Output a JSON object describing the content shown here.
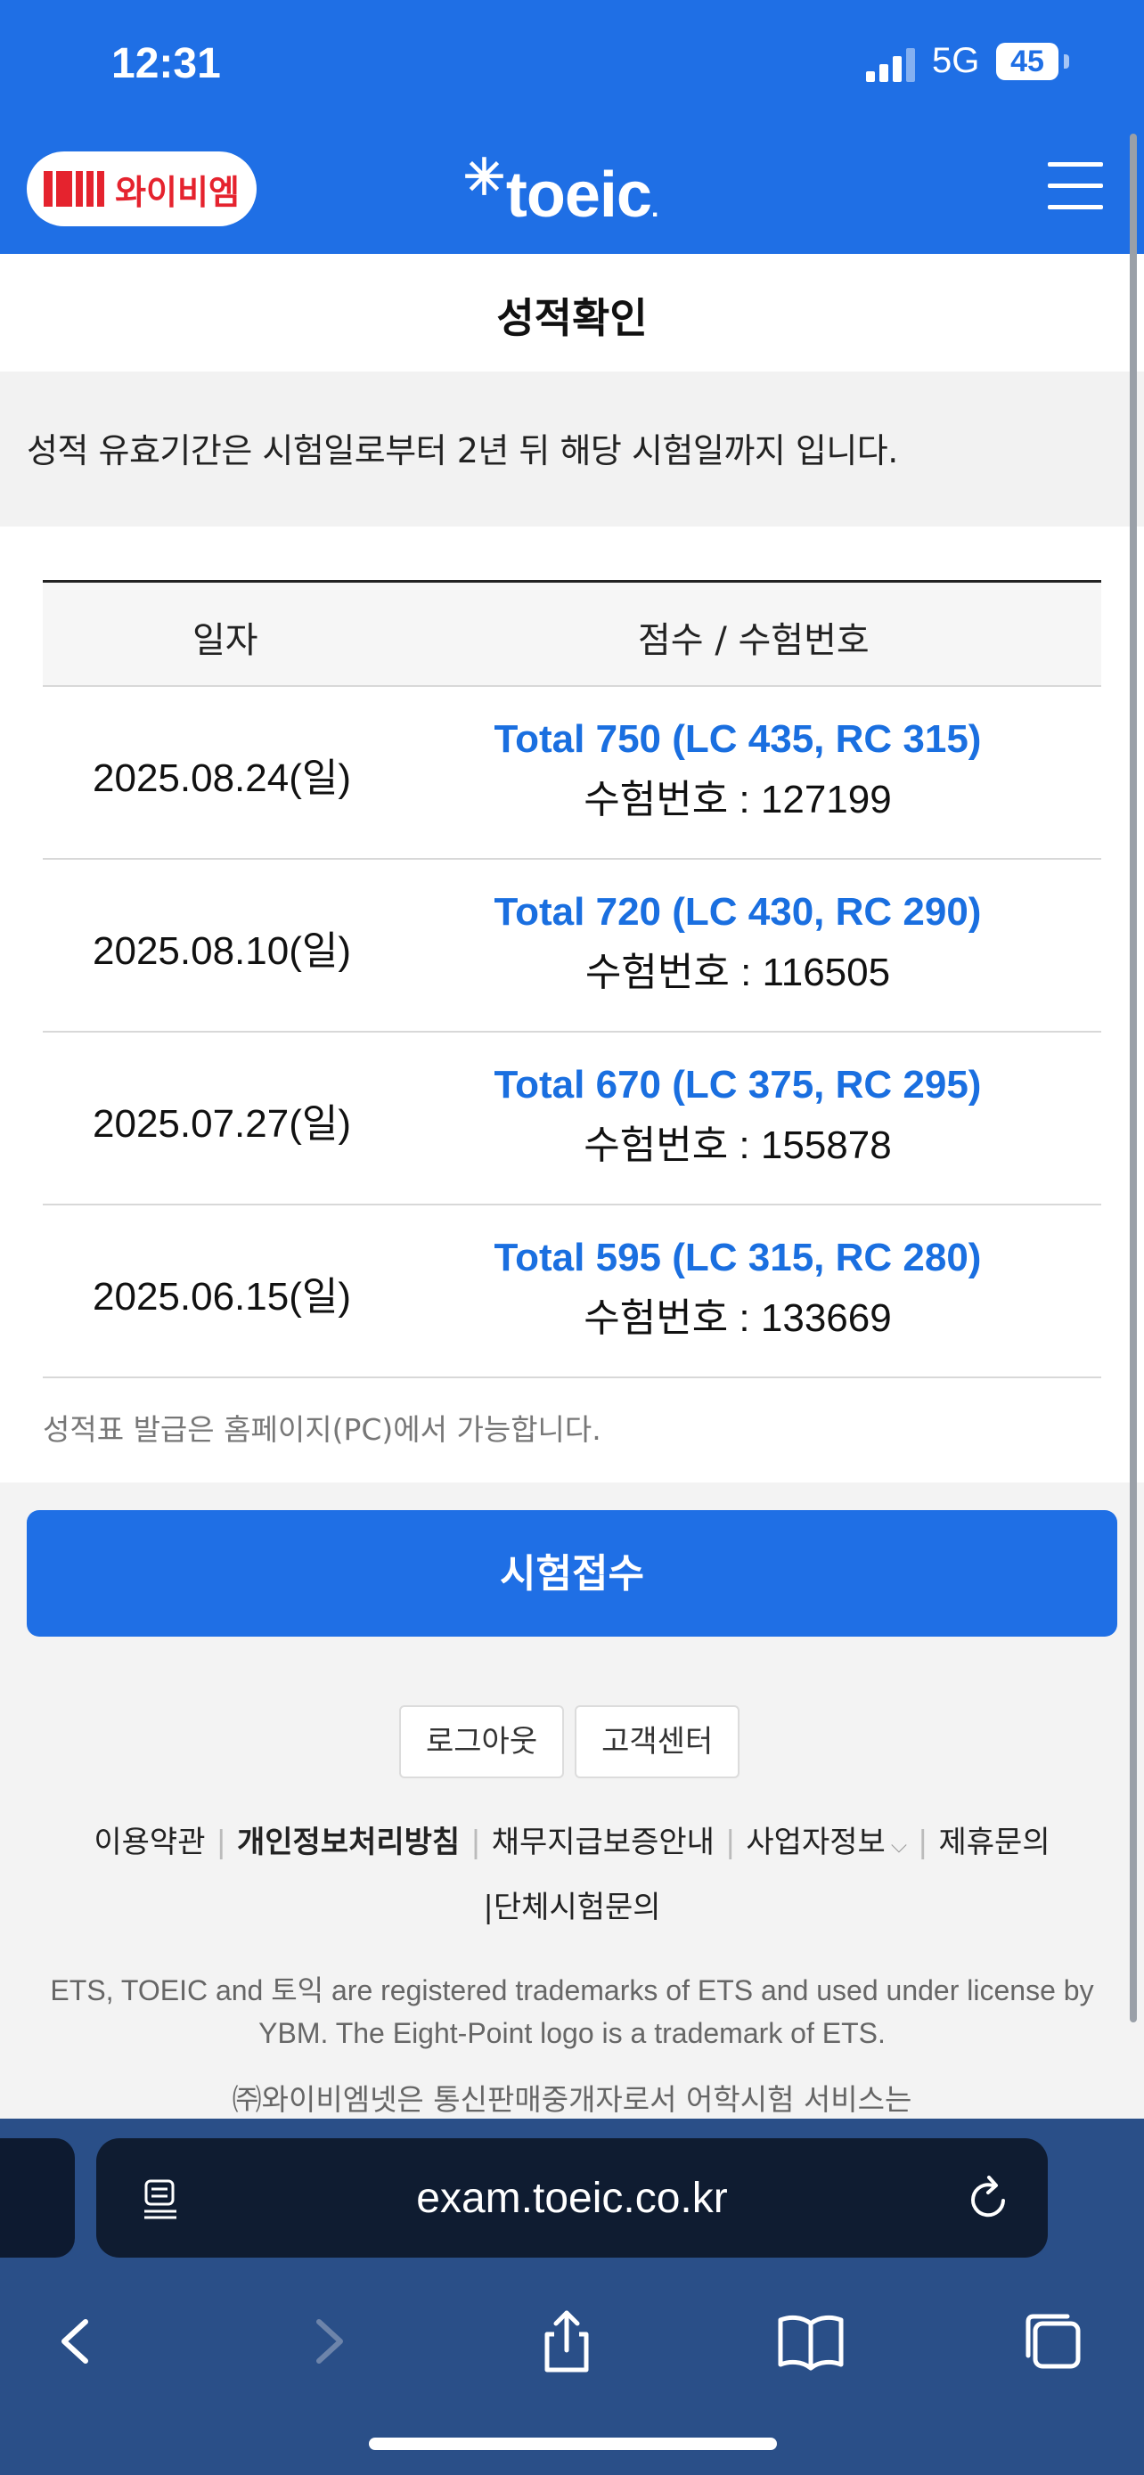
{
  "status": {
    "time": "12:31",
    "network": "5G",
    "battery": "45"
  },
  "header": {
    "ybm_brand": "와이비엠",
    "toeic_brand": "toeic"
  },
  "page": {
    "title": "성적확인",
    "notice": "성적 유효기간은 시험일로부터 2년 뒤 해당 시험일까지 입니다."
  },
  "table": {
    "headers": [
      "일자",
      "점수 / 수험번호"
    ],
    "rows": [
      {
        "date": "2025.08.24(일)",
        "total": "Total 750 (LC 435, RC 315)",
        "regno": "수험번호 : 127199"
      },
      {
        "date": "2025.08.10(일)",
        "total": "Total 720 (LC 430, RC 290)",
        "regno": "수험번호 : 116505"
      },
      {
        "date": "2025.07.27(일)",
        "total": "Total 670 (LC 375, RC 295)",
        "regno": "수험번호 : 155878"
      },
      {
        "date": "2025.06.15(일)",
        "total": "Total 595 (LC 315, RC 280)",
        "regno": "수험번호 : 133669"
      }
    ],
    "footnote": "성적표 발급은 홈페이지(PC)에서 가능합니다."
  },
  "actions": {
    "apply": "시험접수",
    "logout": "로그아웃",
    "support": "고객센터"
  },
  "footer": {
    "links": [
      "이용약관",
      "개인정보처리방침",
      "채무지급보증안내",
      "사업자정보",
      "제휴문의",
      "단체시험문의"
    ],
    "trademark": "ETS, TOEIC and 토익 are registered trademarks of ETS and used under license by YBM. The Eight-Point logo is a trademark of ETS.",
    "company": "㈜와이비엠넷은 통신판매중개자로서 어학시험 서비스는"
  },
  "browser": {
    "url": "exam.toeic.co.kr"
  },
  "colors": {
    "brand_blue": "#1f6fe5",
    "score_blue": "#1a6fe0"
  }
}
